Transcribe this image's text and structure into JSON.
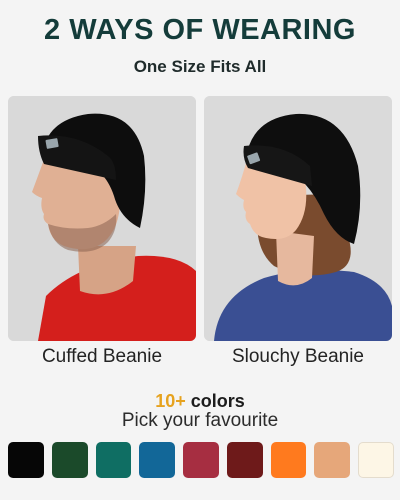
{
  "header": {
    "title": "2 WAYS OF WEARING",
    "subtitle": "One Size Fits All"
  },
  "styles": [
    {
      "label": "Cuffed Beanie"
    },
    {
      "label": "Slouchy Beanie"
    }
  ],
  "colors_section": {
    "count_highlight": "10+",
    "count_word": "colors",
    "tagline": "Pick your favourite"
  },
  "swatches": [
    {
      "name": "black",
      "hex": "#060606"
    },
    {
      "name": "dark-green",
      "hex": "#1b4a2a"
    },
    {
      "name": "teal",
      "hex": "#0f6e63"
    },
    {
      "name": "blue",
      "hex": "#126798"
    },
    {
      "name": "red",
      "hex": "#a62e41"
    },
    {
      "name": "maroon",
      "hex": "#6e1a1a"
    },
    {
      "name": "orange",
      "hex": "#ff7a1e"
    },
    {
      "name": "tan",
      "hex": "#e6a77a"
    },
    {
      "name": "cream",
      "hex": "#fdf6e6"
    }
  ]
}
